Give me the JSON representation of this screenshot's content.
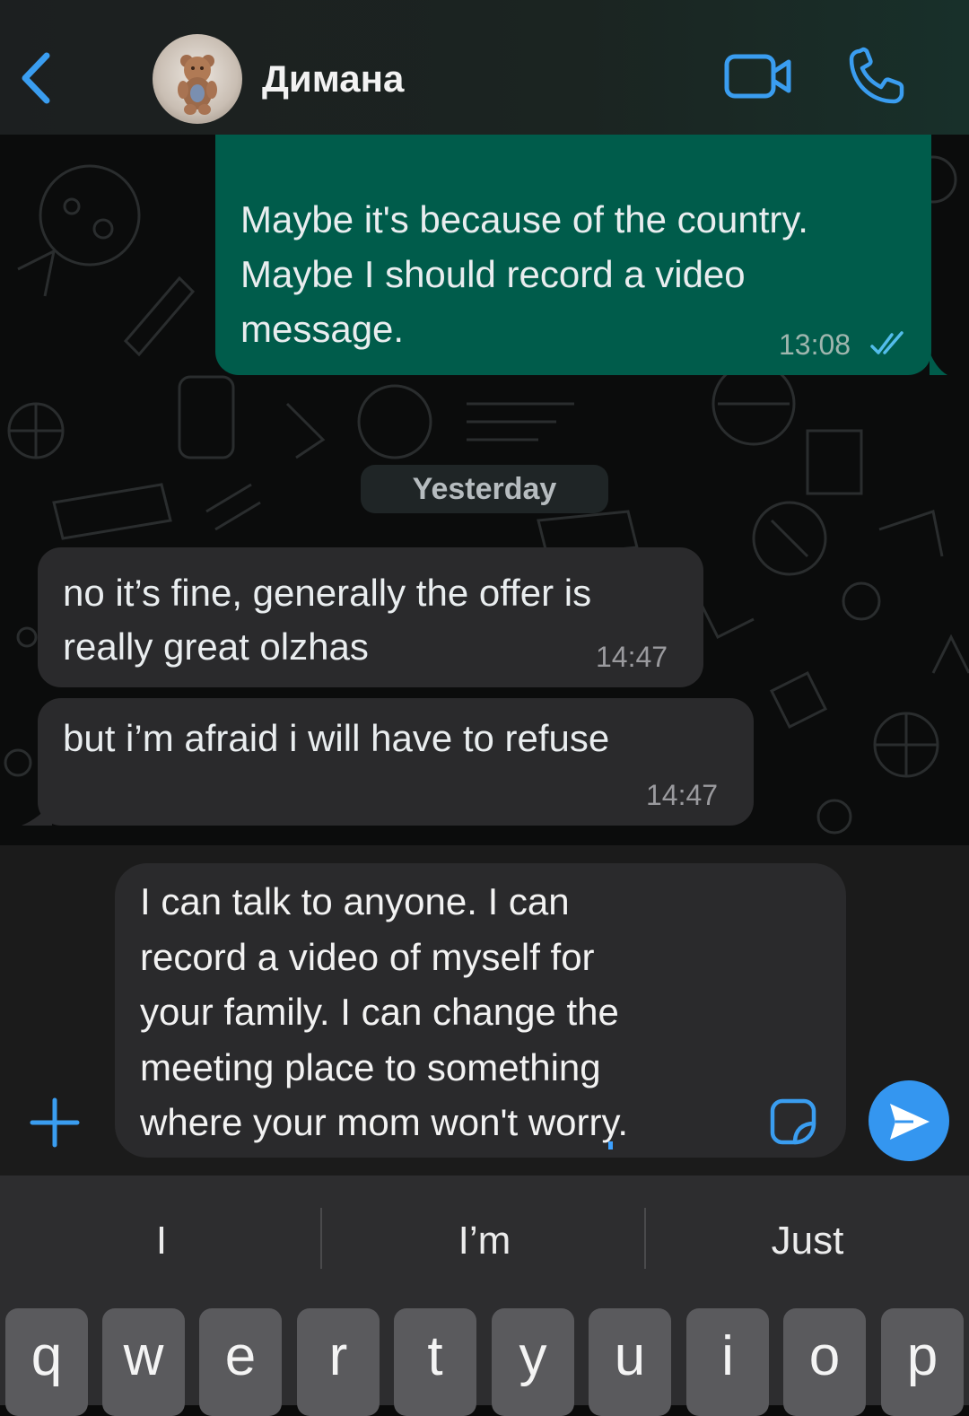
{
  "header": {
    "contact_name": "Димана",
    "back_icon": "chevron-left-icon",
    "video_icon": "video-camera-icon",
    "call_icon": "phone-icon",
    "accent_color": "#3a9df0"
  },
  "messages": {
    "outgoing": {
      "lines": [
        "Maybe it's because of the country.",
        "Maybe I should record a video",
        "message."
      ],
      "time": "13:08",
      "status_icon": "double-check-icon"
    },
    "day_separator": "Yesterday",
    "incoming": [
      {
        "lines": [
          "no it’s fine, generally the offer is",
          "really great olzhas"
        ],
        "time": "14:47"
      },
      {
        "lines": [
          "but i’m afraid i will have to refuse"
        ],
        "time": "14:47"
      }
    ]
  },
  "composer": {
    "draft_lines": [
      "I can talk to anyone. I can",
      "record a video of myself for",
      "your family. I can change the",
      "meeting place to something",
      "where your mom won't worry."
    ],
    "plus_icon": "plus-icon",
    "sticker_icon": "sticker-icon",
    "send_icon": "send-arrow-icon"
  },
  "keyboard": {
    "suggestions": [
      "I",
      "I’m",
      "Just"
    ],
    "row1": [
      "q",
      "w",
      "e",
      "r",
      "t",
      "y",
      "u",
      "i",
      "o",
      "p"
    ]
  }
}
